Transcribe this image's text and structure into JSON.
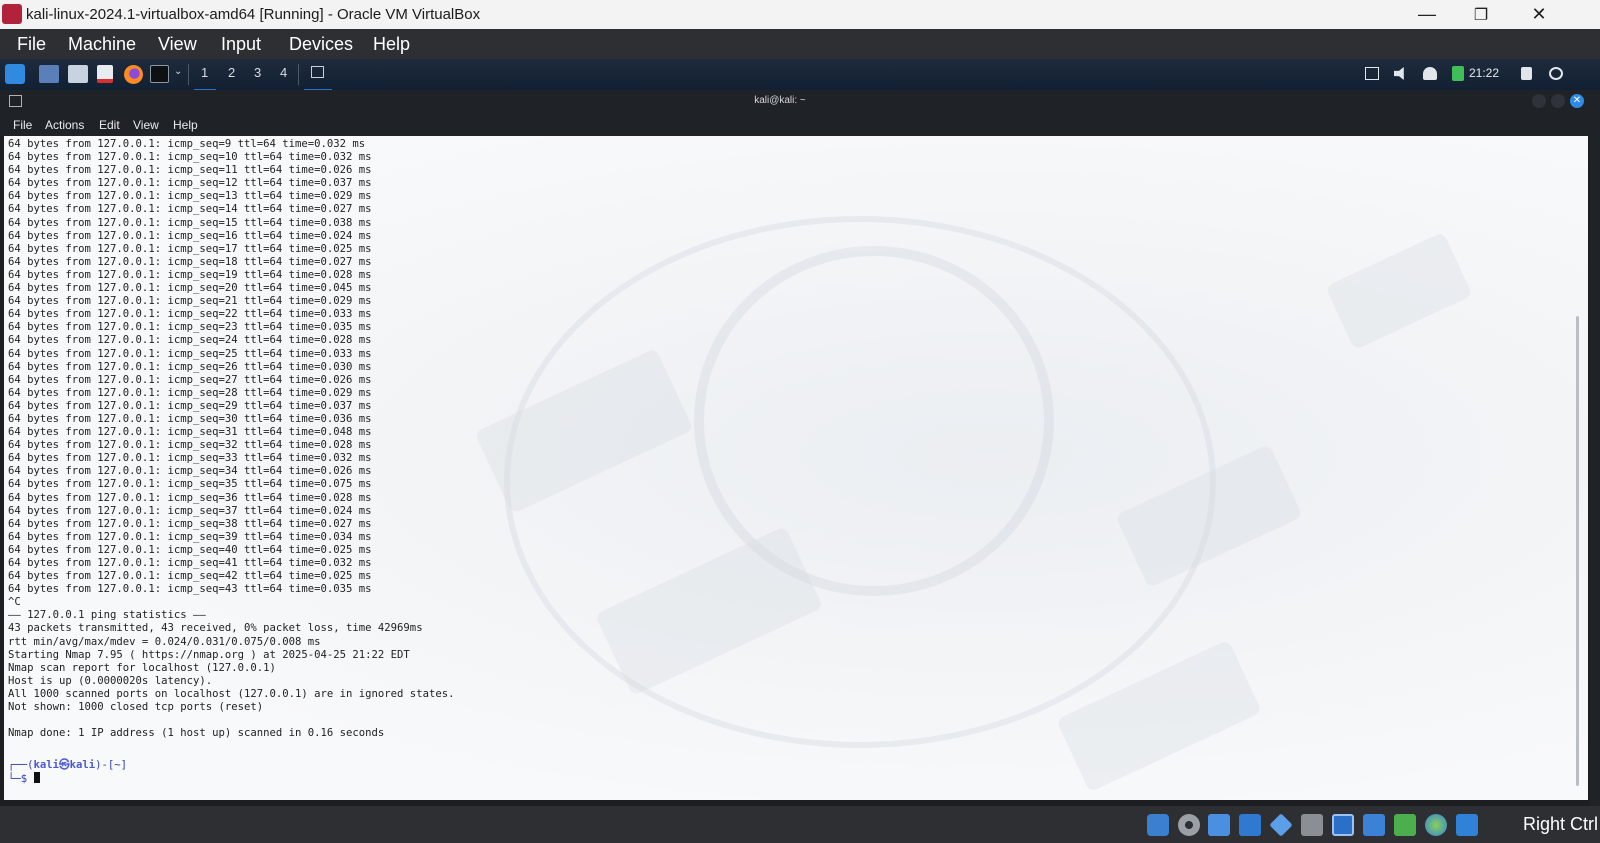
{
  "window": {
    "title": "kali-linux-2024.1-virtualbox-amd64 [Running] - Oracle VM VirtualBox",
    "minimize": "—",
    "restore": "❐",
    "close": "✕"
  },
  "vbox_menu": [
    "File",
    "Machine",
    "View",
    "Input",
    "Devices",
    "Help"
  ],
  "panel": {
    "workspaces": [
      "1",
      "2",
      "3",
      "4"
    ],
    "clock": "21:22",
    "icons": [
      "kali-menu-icon",
      "desktop-icon",
      "file-manager-icon",
      "text-editor-icon",
      "firefox-icon",
      "terminal-icon"
    ]
  },
  "terminal": {
    "title": "kali@kali: ~",
    "menu": [
      "File",
      "Actions",
      "Edit",
      "View",
      "Help"
    ],
    "lines": [
      "64 bytes from 127.0.0.1: icmp_seq=9 ttl=64 time=0.032 ms",
      "64 bytes from 127.0.0.1: icmp_seq=10 ttl=64 time=0.032 ms",
      "64 bytes from 127.0.0.1: icmp_seq=11 ttl=64 time=0.026 ms",
      "64 bytes from 127.0.0.1: icmp_seq=12 ttl=64 time=0.037 ms",
      "64 bytes from 127.0.0.1: icmp_seq=13 ttl=64 time=0.029 ms",
      "64 bytes from 127.0.0.1: icmp_seq=14 ttl=64 time=0.027 ms",
      "64 bytes from 127.0.0.1: icmp_seq=15 ttl=64 time=0.038 ms",
      "64 bytes from 127.0.0.1: icmp_seq=16 ttl=64 time=0.024 ms",
      "64 bytes from 127.0.0.1: icmp_seq=17 ttl=64 time=0.025 ms",
      "64 bytes from 127.0.0.1: icmp_seq=18 ttl=64 time=0.027 ms",
      "64 bytes from 127.0.0.1: icmp_seq=19 ttl=64 time=0.028 ms",
      "64 bytes from 127.0.0.1: icmp_seq=20 ttl=64 time=0.045 ms",
      "64 bytes from 127.0.0.1: icmp_seq=21 ttl=64 time=0.029 ms",
      "64 bytes from 127.0.0.1: icmp_seq=22 ttl=64 time=0.033 ms",
      "64 bytes from 127.0.0.1: icmp_seq=23 ttl=64 time=0.035 ms",
      "64 bytes from 127.0.0.1: icmp_seq=24 ttl=64 time=0.028 ms",
      "64 bytes from 127.0.0.1: icmp_seq=25 ttl=64 time=0.033 ms",
      "64 bytes from 127.0.0.1: icmp_seq=26 ttl=64 time=0.030 ms",
      "64 bytes from 127.0.0.1: icmp_seq=27 ttl=64 time=0.026 ms",
      "64 bytes from 127.0.0.1: icmp_seq=28 ttl=64 time=0.029 ms",
      "64 bytes from 127.0.0.1: icmp_seq=29 ttl=64 time=0.037 ms",
      "64 bytes from 127.0.0.1: icmp_seq=30 ttl=64 time=0.036 ms",
      "64 bytes from 127.0.0.1: icmp_seq=31 ttl=64 time=0.048 ms",
      "64 bytes from 127.0.0.1: icmp_seq=32 ttl=64 time=0.028 ms",
      "64 bytes from 127.0.0.1: icmp_seq=33 ttl=64 time=0.032 ms",
      "64 bytes from 127.0.0.1: icmp_seq=34 ttl=64 time=0.026 ms",
      "64 bytes from 127.0.0.1: icmp_seq=35 ttl=64 time=0.075 ms",
      "64 bytes from 127.0.0.1: icmp_seq=36 ttl=64 time=0.028 ms",
      "64 bytes from 127.0.0.1: icmp_seq=37 ttl=64 time=0.024 ms",
      "64 bytes from 127.0.0.1: icmp_seq=38 ttl=64 time=0.027 ms",
      "64 bytes from 127.0.0.1: icmp_seq=39 ttl=64 time=0.034 ms",
      "64 bytes from 127.0.0.1: icmp_seq=40 ttl=64 time=0.025 ms",
      "64 bytes from 127.0.0.1: icmp_seq=41 ttl=64 time=0.032 ms",
      "64 bytes from 127.0.0.1: icmp_seq=42 ttl=64 time=0.025 ms",
      "64 bytes from 127.0.0.1: icmp_seq=43 ttl=64 time=0.035 ms",
      "^C",
      "—— 127.0.0.1 ping statistics ——",
      "43 packets transmitted, 43 received, 0% packet loss, time 42969ms",
      "rtt min/avg/max/mdev = 0.024/0.031/0.075/0.008 ms",
      "Starting Nmap 7.95 ( https://nmap.org ) at 2025-04-25 21:22 EDT",
      "Nmap scan report for localhost (127.0.0.1)",
      "Host is up (0.0000020s latency).",
      "All 1000 scanned ports on localhost (127.0.0.1) are in ignored states.",
      "Not shown: 1000 closed tcp ports (reset)",
      "",
      "Nmap done: 1 IP address (1 host up) scanned in 0.16 seconds"
    ],
    "prompt_open": "┌──(",
    "prompt_user": "kali㉿kali",
    "prompt_dir": ")-[~]",
    "prompt_line2": "└─$ "
  },
  "status_bar": {
    "host_key": "Right Ctrl",
    "icons": [
      "hard-disk-icon",
      "optical-drive-icon",
      "audio-icon",
      "network-icon",
      "usb-icon",
      "shared-folder-icon",
      "display-icon",
      "recording-icon",
      "cpu-icon",
      "mouse-integration-icon",
      "keyboard-capture-icon"
    ]
  },
  "colors": {
    "accent": "#2d6fd2",
    "kali_red": "#b0233a",
    "prompt_blue": "#2a3fb3"
  }
}
